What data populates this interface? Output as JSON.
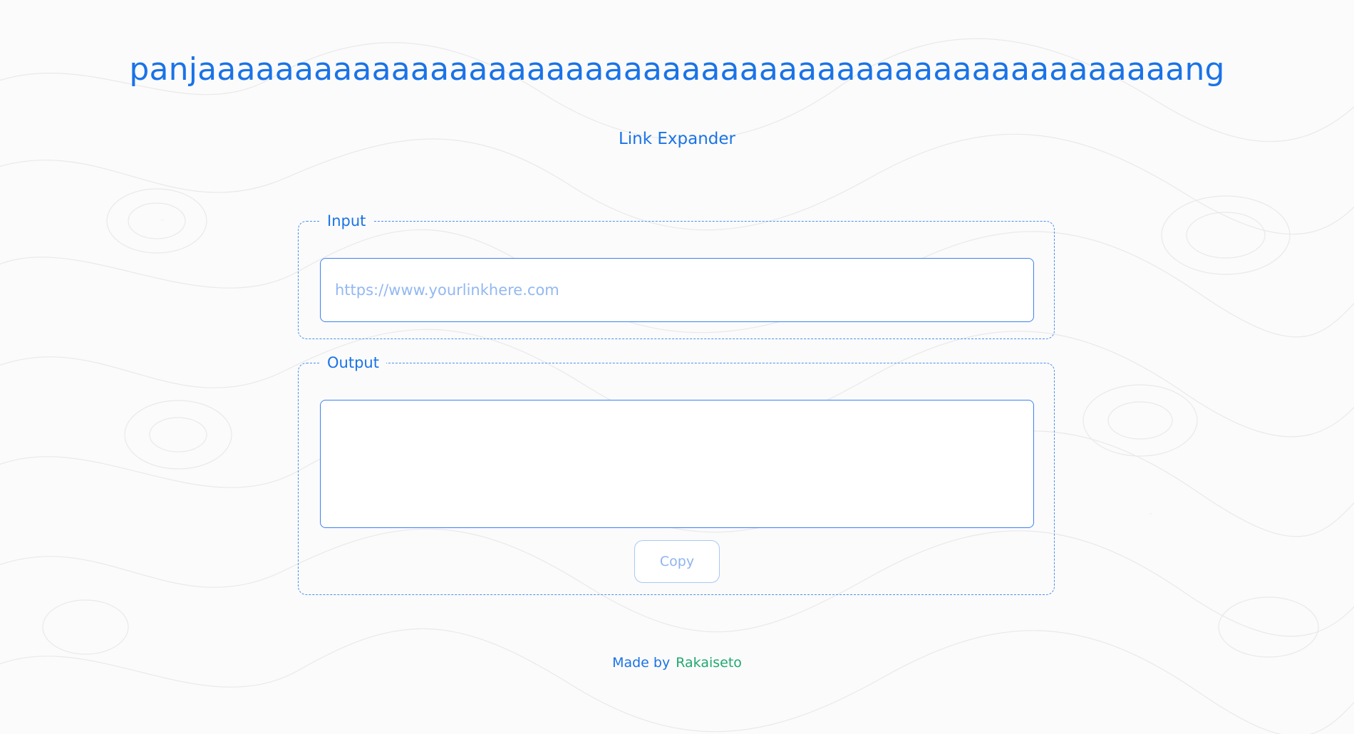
{
  "header": {
    "title": "panjaaaaaaaaaaaaaaaaaaaaaaaaaaaaaaaaaaaaaaaaaaaaaaaaaaang",
    "subtitle": "Link Expander"
  },
  "input_section": {
    "legend": "Input",
    "placeholder": "https://www.yourlinkhere.com",
    "value": ""
  },
  "output_section": {
    "legend": "Output",
    "value": "",
    "copy_label": "Copy"
  },
  "footer": {
    "made_by": "Made by",
    "author": "Rakaiseto"
  },
  "colors": {
    "accent": "#1a73e8",
    "author_link": "#20a871",
    "border": "#3b82f0",
    "background": "#fbfbfb"
  }
}
